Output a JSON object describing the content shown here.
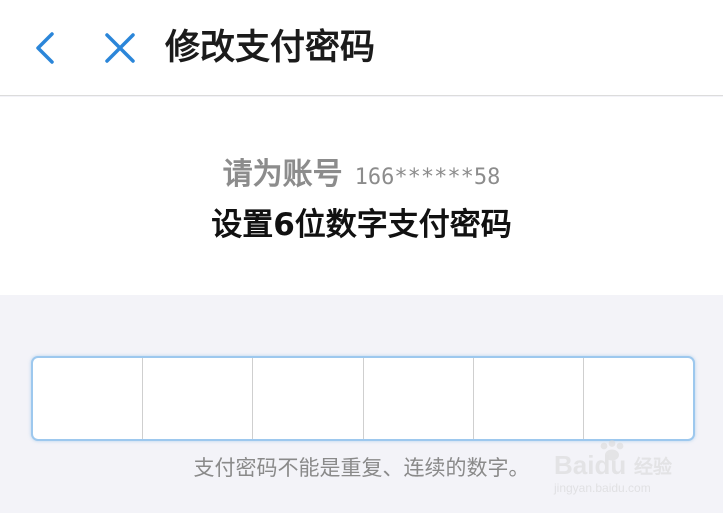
{
  "header": {
    "title": "修改支付密码",
    "back_icon": "chevron-left-icon",
    "close_icon": "close-icon",
    "accent_color": "#2b86d9"
  },
  "prompt": {
    "line1_prefix": "请为账号",
    "account": "166******58",
    "line2": "设置6位数字支付密码"
  },
  "pin": {
    "length": 6,
    "filled": 0,
    "border_color": "#9dc8ee"
  },
  "hint": "支付密码不能是重复、连续的数字。",
  "watermark": {
    "brand": "Baidu",
    "label": "经验",
    "url": "jingyan.baidu.com"
  }
}
